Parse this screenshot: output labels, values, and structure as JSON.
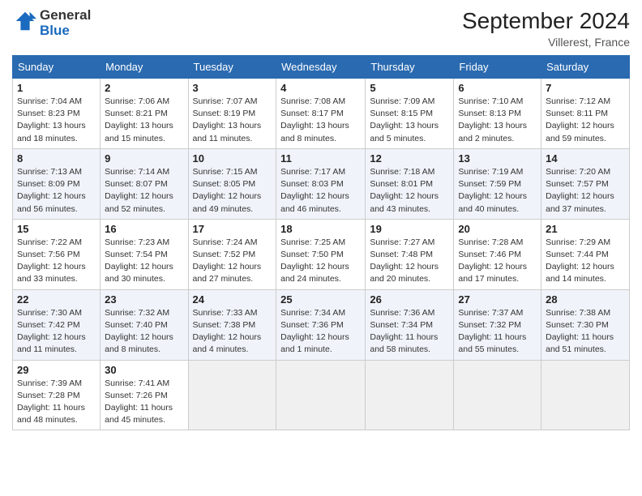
{
  "header": {
    "logo_line1": "General",
    "logo_line2": "Blue",
    "month": "September 2024",
    "location": "Villerest, France"
  },
  "weekdays": [
    "Sunday",
    "Monday",
    "Tuesday",
    "Wednesday",
    "Thursday",
    "Friday",
    "Saturday"
  ],
  "weeks": [
    [
      {
        "day": "1",
        "lines": [
          "Sunrise: 7:04 AM",
          "Sunset: 8:23 PM",
          "Daylight: 13 hours",
          "and 18 minutes."
        ]
      },
      {
        "day": "2",
        "lines": [
          "Sunrise: 7:06 AM",
          "Sunset: 8:21 PM",
          "Daylight: 13 hours",
          "and 15 minutes."
        ]
      },
      {
        "day": "3",
        "lines": [
          "Sunrise: 7:07 AM",
          "Sunset: 8:19 PM",
          "Daylight: 13 hours",
          "and 11 minutes."
        ]
      },
      {
        "day": "4",
        "lines": [
          "Sunrise: 7:08 AM",
          "Sunset: 8:17 PM",
          "Daylight: 13 hours",
          "and 8 minutes."
        ]
      },
      {
        "day": "5",
        "lines": [
          "Sunrise: 7:09 AM",
          "Sunset: 8:15 PM",
          "Daylight: 13 hours",
          "and 5 minutes."
        ]
      },
      {
        "day": "6",
        "lines": [
          "Sunrise: 7:10 AM",
          "Sunset: 8:13 PM",
          "Daylight: 13 hours",
          "and 2 minutes."
        ]
      },
      {
        "day": "7",
        "lines": [
          "Sunrise: 7:12 AM",
          "Sunset: 8:11 PM",
          "Daylight: 12 hours",
          "and 59 minutes."
        ]
      }
    ],
    [
      {
        "day": "8",
        "lines": [
          "Sunrise: 7:13 AM",
          "Sunset: 8:09 PM",
          "Daylight: 12 hours",
          "and 56 minutes."
        ]
      },
      {
        "day": "9",
        "lines": [
          "Sunrise: 7:14 AM",
          "Sunset: 8:07 PM",
          "Daylight: 12 hours",
          "and 52 minutes."
        ]
      },
      {
        "day": "10",
        "lines": [
          "Sunrise: 7:15 AM",
          "Sunset: 8:05 PM",
          "Daylight: 12 hours",
          "and 49 minutes."
        ]
      },
      {
        "day": "11",
        "lines": [
          "Sunrise: 7:17 AM",
          "Sunset: 8:03 PM",
          "Daylight: 12 hours",
          "and 46 minutes."
        ]
      },
      {
        "day": "12",
        "lines": [
          "Sunrise: 7:18 AM",
          "Sunset: 8:01 PM",
          "Daylight: 12 hours",
          "and 43 minutes."
        ]
      },
      {
        "day": "13",
        "lines": [
          "Sunrise: 7:19 AM",
          "Sunset: 7:59 PM",
          "Daylight: 12 hours",
          "and 40 minutes."
        ]
      },
      {
        "day": "14",
        "lines": [
          "Sunrise: 7:20 AM",
          "Sunset: 7:57 PM",
          "Daylight: 12 hours",
          "and 37 minutes."
        ]
      }
    ],
    [
      {
        "day": "15",
        "lines": [
          "Sunrise: 7:22 AM",
          "Sunset: 7:56 PM",
          "Daylight: 12 hours",
          "and 33 minutes."
        ]
      },
      {
        "day": "16",
        "lines": [
          "Sunrise: 7:23 AM",
          "Sunset: 7:54 PM",
          "Daylight: 12 hours",
          "and 30 minutes."
        ]
      },
      {
        "day": "17",
        "lines": [
          "Sunrise: 7:24 AM",
          "Sunset: 7:52 PM",
          "Daylight: 12 hours",
          "and 27 minutes."
        ]
      },
      {
        "day": "18",
        "lines": [
          "Sunrise: 7:25 AM",
          "Sunset: 7:50 PM",
          "Daylight: 12 hours",
          "and 24 minutes."
        ]
      },
      {
        "day": "19",
        "lines": [
          "Sunrise: 7:27 AM",
          "Sunset: 7:48 PM",
          "Daylight: 12 hours",
          "and 20 minutes."
        ]
      },
      {
        "day": "20",
        "lines": [
          "Sunrise: 7:28 AM",
          "Sunset: 7:46 PM",
          "Daylight: 12 hours",
          "and 17 minutes."
        ]
      },
      {
        "day": "21",
        "lines": [
          "Sunrise: 7:29 AM",
          "Sunset: 7:44 PM",
          "Daylight: 12 hours",
          "and 14 minutes."
        ]
      }
    ],
    [
      {
        "day": "22",
        "lines": [
          "Sunrise: 7:30 AM",
          "Sunset: 7:42 PM",
          "Daylight: 12 hours",
          "and 11 minutes."
        ]
      },
      {
        "day": "23",
        "lines": [
          "Sunrise: 7:32 AM",
          "Sunset: 7:40 PM",
          "Daylight: 12 hours",
          "and 8 minutes."
        ]
      },
      {
        "day": "24",
        "lines": [
          "Sunrise: 7:33 AM",
          "Sunset: 7:38 PM",
          "Daylight: 12 hours",
          "and 4 minutes."
        ]
      },
      {
        "day": "25",
        "lines": [
          "Sunrise: 7:34 AM",
          "Sunset: 7:36 PM",
          "Daylight: 12 hours",
          "and 1 minute."
        ]
      },
      {
        "day": "26",
        "lines": [
          "Sunrise: 7:36 AM",
          "Sunset: 7:34 PM",
          "Daylight: 11 hours",
          "and 58 minutes."
        ]
      },
      {
        "day": "27",
        "lines": [
          "Sunrise: 7:37 AM",
          "Sunset: 7:32 PM",
          "Daylight: 11 hours",
          "and 55 minutes."
        ]
      },
      {
        "day": "28",
        "lines": [
          "Sunrise: 7:38 AM",
          "Sunset: 7:30 PM",
          "Daylight: 11 hours",
          "and 51 minutes."
        ]
      }
    ],
    [
      {
        "day": "29",
        "lines": [
          "Sunrise: 7:39 AM",
          "Sunset: 7:28 PM",
          "Daylight: 11 hours",
          "and 48 minutes."
        ]
      },
      {
        "day": "30",
        "lines": [
          "Sunrise: 7:41 AM",
          "Sunset: 7:26 PM",
          "Daylight: 11 hours",
          "and 45 minutes."
        ]
      },
      {
        "day": "",
        "lines": []
      },
      {
        "day": "",
        "lines": []
      },
      {
        "day": "",
        "lines": []
      },
      {
        "day": "",
        "lines": []
      },
      {
        "day": "",
        "lines": []
      }
    ]
  ]
}
